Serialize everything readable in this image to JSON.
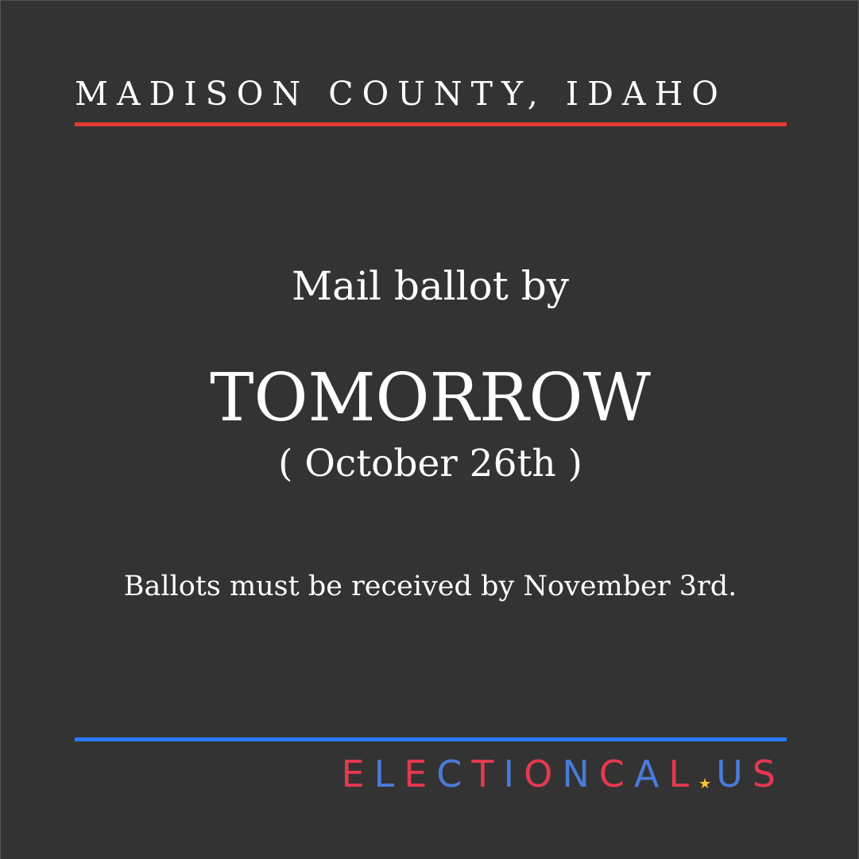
{
  "location": "MADISON COUNTY, IDAHO",
  "lead_text": "Mail ballot by",
  "deadline_word": "TOMORROW",
  "deadline_date": "( October 26th )",
  "note": "Ballots must be received by November 3rd.",
  "brand": {
    "left": "ELECTIONCAL",
    "right": "US",
    "separator_icon": "star-icon"
  },
  "colors": {
    "background": "#333333",
    "text": "#ffffff",
    "rule_top": "#e53935",
    "rule_bottom": "#2979ff",
    "brand_red": "#e53950",
    "brand_blue": "#4a7bd8",
    "brand_star": "#f7c331"
  }
}
